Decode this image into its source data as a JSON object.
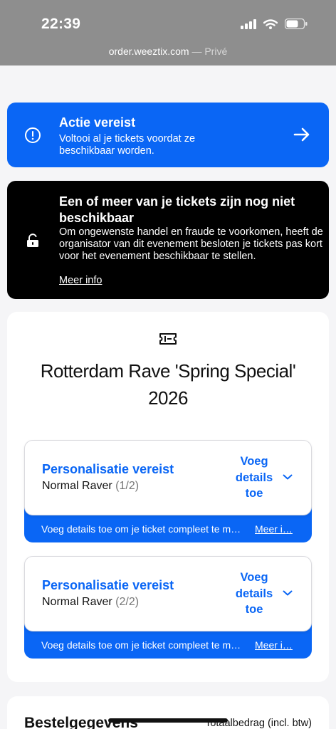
{
  "status_bar": {
    "time": "22:39"
  },
  "browser": {
    "domain": "order.weeztix.com",
    "privacy": "— Privé"
  },
  "action_banner": {
    "title": "Actie vereist",
    "description": "Voltooi al je tickets voordat ze beschikbaar worden."
  },
  "notice": {
    "title": "Een of meer van je tickets zijn nog niet beschikbaar",
    "description": "Om ongewenste handel en fraude te voorkomen, heeft de organisator van dit evenement besloten je tickets pas kort voor het evenement beschikbaar te stellen.",
    "link": "Meer info"
  },
  "event": {
    "name": "Rotterdam Rave 'Spring Special' 2026",
    "tickets": [
      {
        "status": "Personalisatie vereist",
        "type": "Normal Raver",
        "count": "(1/2)",
        "action": "Voeg details toe",
        "hint": "Voeg details toe om je ticket compleet te m…",
        "hint_link": "Meer i…"
      },
      {
        "status": "Personalisatie vereist",
        "type": "Normal Raver",
        "count": "(2/2)",
        "action": "Voeg details toe",
        "hint": "Voeg details toe om je ticket compleet te m…",
        "hint_link": "Meer i…"
      }
    ]
  },
  "order": {
    "title": "Bestelgegevens",
    "total_label": "Totaalbedrag (incl. btw)"
  },
  "colors": {
    "accent": "#0a66f5",
    "notice_bg": "#000000"
  }
}
